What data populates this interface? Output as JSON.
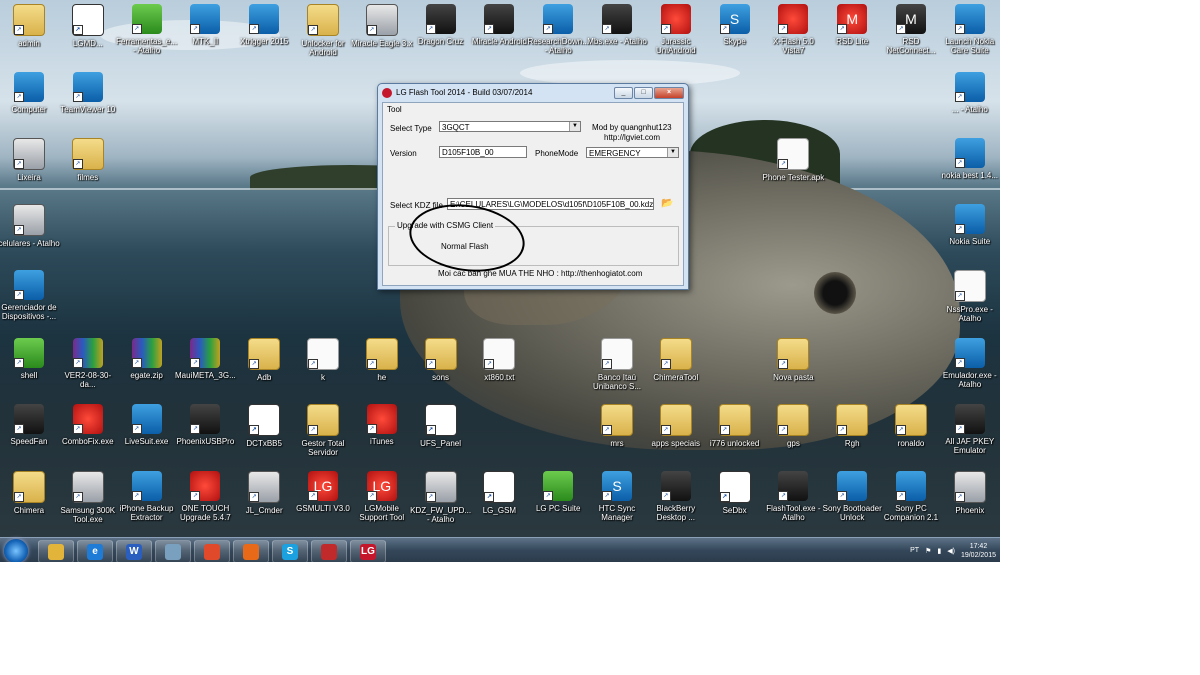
{
  "desktop_icons": [
    {
      "label": "admin",
      "icon": "user-folder",
      "style": "folder"
    },
    {
      "label": "LGMD...",
      "icon": "ds310",
      "style": "ds"
    },
    {
      "label": "Ferramentas_e... - Atalho",
      "icon": "android",
      "style": "green"
    },
    {
      "label": "MTK_II",
      "icon": "anchor",
      "style": "blue"
    },
    {
      "label": "Xtrigger 2015",
      "icon": "unlock",
      "style": "blue"
    },
    {
      "label": "Unlocker for Android",
      "icon": "lock",
      "style": "folder"
    },
    {
      "label": "Miracle Eagle 3.x",
      "icon": "drive",
      "style": "tool"
    },
    {
      "label": "Dragon Cruz",
      "icon": "person",
      "style": "dark"
    },
    {
      "label": "Miracle Android",
      "icon": "tools",
      "style": "dark"
    },
    {
      "label": "ResearchDown... - Atalho",
      "icon": "arrows",
      "style": "blue"
    },
    {
      "label": "Mbs.exe - Atalho",
      "icon": "tools",
      "style": "dark"
    },
    {
      "label": "Jurassic UniAndroid",
      "icon": "jurassic",
      "style": "red"
    },
    {
      "label": "Skype",
      "icon": "skype",
      "style": "blue"
    },
    {
      "label": "X-Flash 5.0 Vista7",
      "icon": "flash",
      "style": "red"
    },
    {
      "label": "RSD Lite",
      "icon": "motorola",
      "style": "red"
    },
    {
      "label": "RSD NetConnect...",
      "icon": "motorola",
      "style": "dark"
    },
    {
      "label": "Launch Nokia Care Suite",
      "icon": "nokia",
      "style": "blue"
    },
    {
      "label": "Computer",
      "icon": "computer",
      "style": "blue"
    },
    {
      "label": "TeamViewer 10",
      "icon": "teamviewer",
      "style": "blue"
    },
    {
      "label": "... - Atalho",
      "icon": "nokia-wave",
      "style": "blue"
    },
    {
      "label": "Lixeira",
      "icon": "recycle-bin",
      "style": "tool"
    },
    {
      "label": "filmes",
      "icon": "folder",
      "style": "folder"
    },
    {
      "label": "Phone Tester.apk",
      "icon": "apk",
      "style": "doc"
    },
    {
      "label": "nokia best 1.4...",
      "icon": "nokia-wave",
      "style": "blue"
    },
    {
      "label": "celulares - Atalho",
      "icon": "phone",
      "style": "tool"
    },
    {
      "label": "Nokia Suite",
      "icon": "nokia-suite",
      "style": "blue"
    },
    {
      "label": "Gerenciador de Dispositivos -...",
      "icon": "device-manager",
      "style": "blue"
    },
    {
      "label": "NssPro.exe - Atalho",
      "icon": "nss",
      "style": "doc"
    },
    {
      "label": "shell",
      "icon": "play",
      "style": "green"
    },
    {
      "label": "VER2-08-30-da...",
      "icon": "rar",
      "style": "rar"
    },
    {
      "label": "egate.zip",
      "icon": "rar",
      "style": "rar"
    },
    {
      "label": "MauiMETA_3G...",
      "icon": "rar",
      "style": "rar"
    },
    {
      "label": "Adb",
      "icon": "folder",
      "style": "folder"
    },
    {
      "label": "k",
      "icon": "file",
      "style": "doc"
    },
    {
      "label": "he",
      "icon": "folder",
      "style": "folder"
    },
    {
      "label": "sons",
      "icon": "folder",
      "style": "folder"
    },
    {
      "label": "xt860.txt",
      "icon": "text-file",
      "style": "doc"
    },
    {
      "label": "Banco Itaú Unibanco S...",
      "icon": "pdf",
      "style": "pdf"
    },
    {
      "label": "ChimeraTool",
      "icon": "folder",
      "style": "folder"
    },
    {
      "label": "Nova pasta",
      "icon": "folder",
      "style": "folder"
    },
    {
      "label": "Emulador.exe - Atalho",
      "icon": "emulator",
      "style": "blue"
    },
    {
      "label": "SpeedFan",
      "icon": "fan",
      "style": "dark"
    },
    {
      "label": "ComboFix.exe",
      "icon": "combofix",
      "style": "red"
    },
    {
      "label": "LiveSuit.exe",
      "icon": "livesuit",
      "style": "blue"
    },
    {
      "label": "PhoenixUSBPro",
      "icon": "chip",
      "style": "dark"
    },
    {
      "label": "DCTxBB5",
      "icon": "ds310",
      "style": "ds"
    },
    {
      "label": "Gestor Total Servidor",
      "icon": "bars",
      "style": "folder"
    },
    {
      "label": "iTunes",
      "icon": "itunes",
      "style": "red"
    },
    {
      "label": "UFS_Panel",
      "icon": "ds310",
      "style": "ds"
    },
    {
      "label": "mrs",
      "icon": "folder",
      "style": "folder"
    },
    {
      "label": "apps speciais",
      "icon": "folder",
      "style": "folder"
    },
    {
      "label": "i776 unlocked",
      "icon": "folder",
      "style": "folder"
    },
    {
      "label": "gps",
      "icon": "folder",
      "style": "folder"
    },
    {
      "label": "Rgh",
      "icon": "folder",
      "style": "folder"
    },
    {
      "label": "ronaldo",
      "icon": "folder",
      "style": "folder"
    },
    {
      "label": "All JAF PKEY Emulator",
      "icon": "grid",
      "style": "dark"
    },
    {
      "label": "Chimera",
      "icon": "chimera",
      "style": "folder"
    },
    {
      "label": "Samsung 300K Tool.exe",
      "icon": "samsung-tool",
      "style": "tool"
    },
    {
      "label": "iPhone Backup Extractor",
      "icon": "iphone-backup",
      "style": "blue"
    },
    {
      "label": "ONE TOUCH Upgrade 5.4.7",
      "icon": "onetouch",
      "style": "red"
    },
    {
      "label": "JL_Cmder",
      "icon": "jl-cmder",
      "style": "tool"
    },
    {
      "label": "GSMULTI V3.0",
      "icon": "lg",
      "style": "red"
    },
    {
      "label": "LGMobile Support Tool",
      "icon": "lg",
      "style": "red"
    },
    {
      "label": "KDZ_FW_UPD... - Atalho",
      "icon": "kdz",
      "style": "tool"
    },
    {
      "label": "LG_GSM",
      "icon": "ds310",
      "style": "ds"
    },
    {
      "label": "LG PC Suite",
      "icon": "lg-pcsuite",
      "style": "green"
    },
    {
      "label": "HTC Sync Manager",
      "icon": "htc",
      "style": "blue"
    },
    {
      "label": "BlackBerry Desktop ...",
      "icon": "blackberry",
      "style": "dark"
    },
    {
      "label": "SeDbx",
      "icon": "ds310",
      "style": "ds"
    },
    {
      "label": "FlashTool.exe - Atalho",
      "icon": "flashtool",
      "style": "dark"
    },
    {
      "label": "Sony Bootloader Unlock",
      "icon": "unlock",
      "style": "blue"
    },
    {
      "label": "Sony PC Companion 2.1",
      "icon": "sony",
      "style": "blue"
    },
    {
      "label": "Phoenix",
      "icon": "phoenix",
      "style": "tool"
    }
  ],
  "window": {
    "title": "LG Flash Tool 2014 - Build 03/07/2014",
    "menu": "Tool",
    "select_type_label": "Select Type",
    "select_type_value": "3GQCT",
    "mod_by": "Mod by quangnhut123",
    "site": "http://lgviet.com",
    "version_label": "Version",
    "version_value": "D105F10B_00",
    "phonemode_label": "PhoneMode",
    "phonemode_value": "EMERGENCY",
    "kdz_label": "Select KDZ file",
    "kdz_value": "E:\\CELULARES\\LG\\MODELOS\\d105f\\D105F10B_00.kdz",
    "group_title": "Upgrade with CSMG Client",
    "normal_flash": "Normal Flash",
    "footer": "Moi cac ban ghe MUA THE NHO : http://thenhogiatot.com"
  },
  "taskbar": {
    "items": [
      {
        "icon": "explorer-icon",
        "label": ""
      },
      {
        "icon": "ie-icon",
        "label": "e"
      },
      {
        "icon": "word-icon",
        "label": "W"
      },
      {
        "icon": "app-icon",
        "label": ""
      },
      {
        "icon": "chrome-icon",
        "label": ""
      },
      {
        "icon": "firefox-icon",
        "label": ""
      },
      {
        "icon": "skype-icon",
        "label": "S"
      },
      {
        "icon": "toolbox-icon",
        "label": ""
      },
      {
        "icon": "lg-icon",
        "label": "LG"
      }
    ],
    "language": "PT",
    "time": "17:42",
    "date": "19/02/2015"
  }
}
